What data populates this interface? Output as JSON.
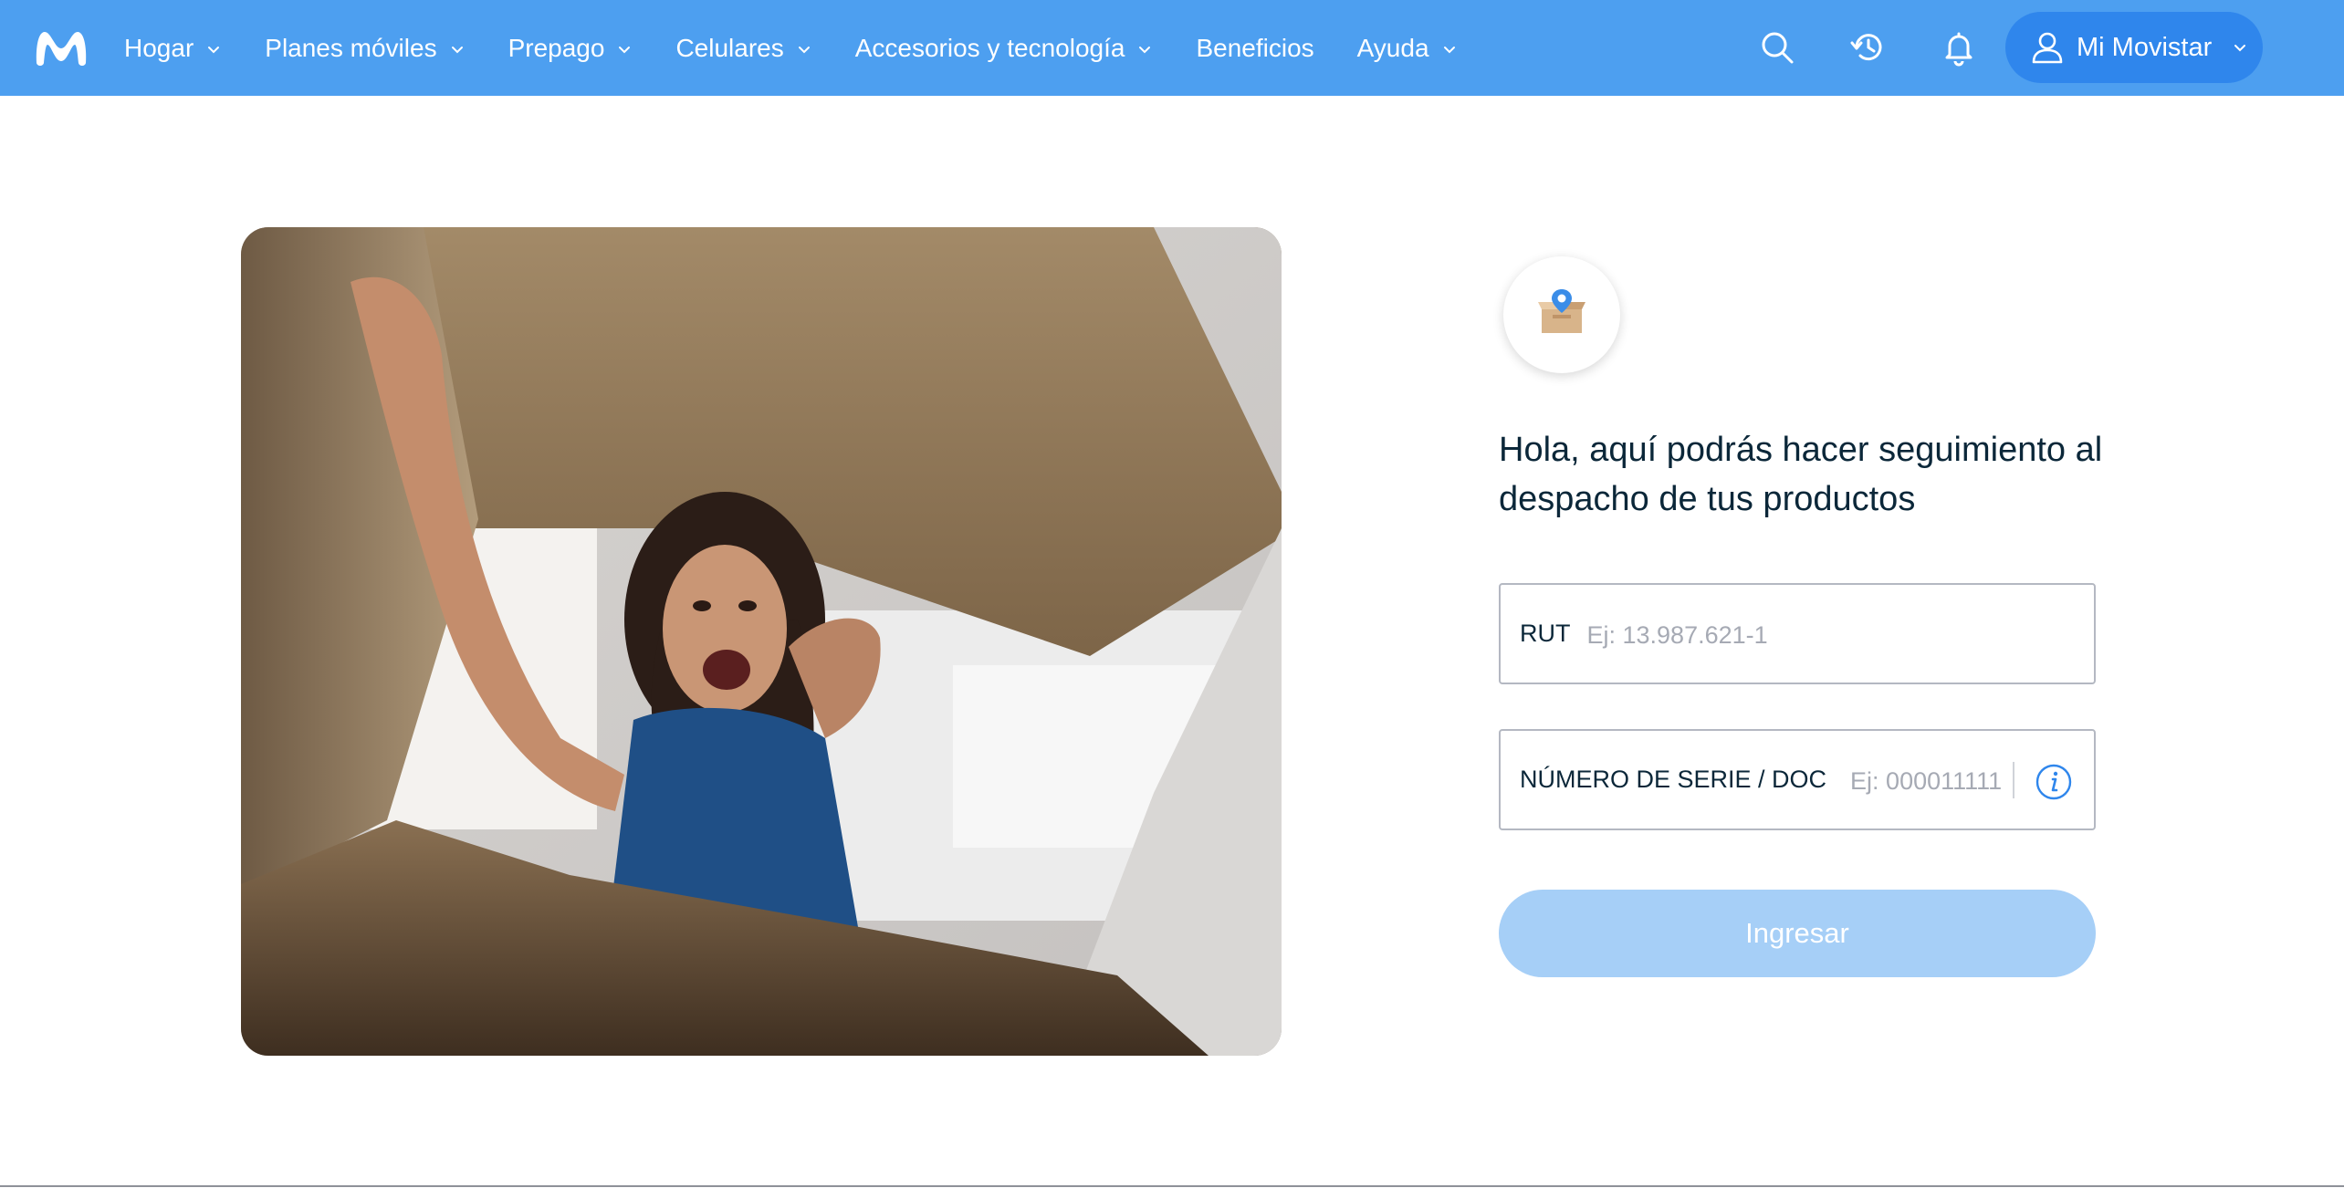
{
  "brand": {
    "name": "Movistar",
    "logo_icon": "movistar-m-logo",
    "accent": "#4d9ff0",
    "accent_dark": "#2f86ec"
  },
  "nav": {
    "items": [
      {
        "label": "Hogar",
        "has_dropdown": true
      },
      {
        "label": "Planes móviles",
        "has_dropdown": true
      },
      {
        "label": "Prepago",
        "has_dropdown": true
      },
      {
        "label": "Celulares",
        "has_dropdown": true
      },
      {
        "label": "Accesorios y tecnología",
        "has_dropdown": true
      },
      {
        "label": "Beneficios",
        "has_dropdown": false
      },
      {
        "label": "Ayuda",
        "has_dropdown": true
      }
    ]
  },
  "header_icons": [
    "search-icon",
    "history-icon",
    "bell-icon"
  ],
  "account": {
    "label": "Mi Movistar",
    "icon": "user-icon"
  },
  "hero": {
    "icon": "photo-woman-opening-box"
  },
  "form": {
    "badge_icon": "package-location-icon",
    "headline": "Hola, aquí podrás hacer seguimiento al despacho de tus productos",
    "rut": {
      "label": "RUT",
      "placeholder": "Ej: 13.987.621-1",
      "value": ""
    },
    "serie": {
      "label": "NÚMERO DE SERIE / DOC",
      "placeholder": "Ej: 000011111",
      "value": "",
      "info_icon": "info-icon"
    },
    "submit_label": "Ingresar",
    "submit_color": "#a6cff7"
  }
}
